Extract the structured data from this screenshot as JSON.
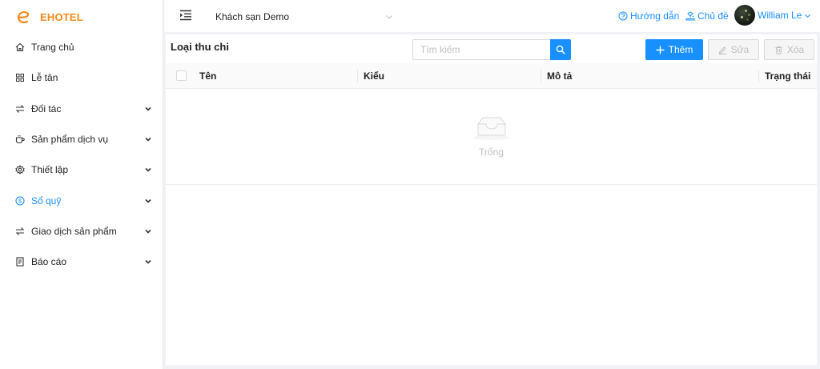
{
  "app": {
    "name": "EHOTEL",
    "brand_color": "#f08a1c",
    "accent_color": "#1890ff"
  },
  "sidebar": {
    "items": [
      {
        "label": "Trang chủ",
        "icon": "home-icon",
        "has_submenu": false,
        "active": false
      },
      {
        "label": "Lễ tân",
        "icon": "grid-icon",
        "has_submenu": false,
        "active": false
      },
      {
        "label": "Đối tác",
        "icon": "swap-icon",
        "has_submenu": true,
        "active": false
      },
      {
        "label": "Sản phẩm dịch vụ",
        "icon": "coffee-icon",
        "has_submenu": true,
        "active": false
      },
      {
        "label": "Thiết lập",
        "icon": "gear-icon",
        "has_submenu": true,
        "active": false
      },
      {
        "label": "Sổ quỹ",
        "icon": "dollar-icon",
        "has_submenu": true,
        "active": true
      },
      {
        "label": "Giao dịch sản phẩm",
        "icon": "swap-icon",
        "has_submenu": true,
        "active": false
      },
      {
        "label": "Báo cáo",
        "icon": "report-icon",
        "has_submenu": true,
        "active": false
      }
    ]
  },
  "header": {
    "hotel_select": "Khách sạn Demo",
    "guide_label": "Hướng dẫn",
    "theme_label": "Chủ đề",
    "user_name": "William Le"
  },
  "page": {
    "title": "Loại thu chi",
    "search_placeholder": "Tìm kiếm",
    "add_label": "Thêm",
    "edit_label": "Sửa",
    "delete_label": "Xóa"
  },
  "table": {
    "columns": [
      "Tên",
      "Kiểu",
      "Mô tả",
      "Trạng thái"
    ],
    "rows": [],
    "empty_text": "Trống"
  }
}
